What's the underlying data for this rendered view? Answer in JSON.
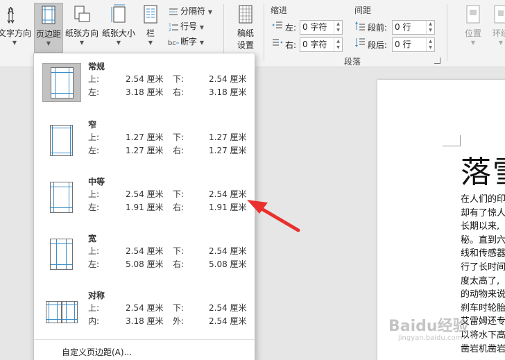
{
  "ribbon": {
    "text_direction": "文字方向",
    "margins": "页边距",
    "orientation": "纸张方向",
    "size": "纸张大小",
    "columns": "栏",
    "breaks": "分隔符",
    "line_numbers": "行号",
    "hyphenation": "断字",
    "draft_paper_line1": "稿纸",
    "draft_paper_line2": "设置",
    "indent": {
      "title": "缩进",
      "left_label": "左:",
      "left_value": "0 字符",
      "right_label": "右:",
      "right_value": "0 字符"
    },
    "spacing": {
      "title": "间距",
      "before_label": "段前:",
      "before_value": "0 行",
      "after_label": "段后:",
      "after_value": "0 行"
    },
    "paragraph_group": "段落",
    "position": "位置",
    "wrap_text": "环绕"
  },
  "margins_menu": {
    "options": [
      {
        "name": "常规",
        "k1": "上:",
        "v1": "2.54 厘米",
        "k2": "下:",
        "v2": "2.54 厘米",
        "k3": "左:",
        "v3": "3.18 厘米",
        "k4": "右:",
        "v4": "3.18 厘米"
      },
      {
        "name": "窄",
        "k1": "上:",
        "v1": "1.27 厘米",
        "k2": "下:",
        "v2": "1.27 厘米",
        "k3": "左:",
        "v3": "1.27 厘米",
        "k4": "右:",
        "v4": "1.27 厘米"
      },
      {
        "name": "中等",
        "k1": "上:",
        "v1": "2.54 厘米",
        "k2": "下:",
        "v2": "2.54 厘米",
        "k3": "左:",
        "v3": "1.91 厘米",
        "k4": "右:",
        "v4": "1.91 厘米"
      },
      {
        "name": "宽",
        "k1": "上:",
        "v1": "2.54 厘米",
        "k2": "下:",
        "v2": "2.54 厘米",
        "k3": "左:",
        "v3": "5.08 厘米",
        "k4": "右:",
        "v4": "5.08 厘米"
      },
      {
        "name": "对称",
        "k1": "上:",
        "v1": "2.54 厘米",
        "k2": "下:",
        "v2": "2.54 厘米",
        "k3": "内:",
        "v3": "3.18 厘米",
        "k4": "外:",
        "v4": "2.54 厘米"
      }
    ],
    "custom": "自定义页边距(A)..."
  },
  "document": {
    "title": "落雪",
    "lines": [
      "在人们的印",
      "却有了惊人",
      "长期以来,",
      "秘。直到六",
      "线和传感器",
      "行了长时间",
      "度太高了,",
      "的动物来说",
      "刹车时轮胎",
      "艾雷姆还专",
      "以将水下高",
      "凿岩机凿岩"
    ]
  },
  "watermark": {
    "brand": "Baidu经验",
    "url": "jingyan.baidu.com"
  },
  "colors": {
    "guide": "#3b8ec9",
    "arrow": "#e8312f",
    "ribbon_bg": "#f3f3f3"
  }
}
